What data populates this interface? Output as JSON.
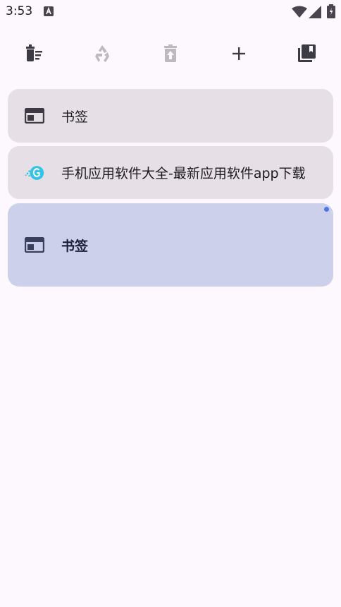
{
  "status_bar": {
    "time": "3:53",
    "icons": [
      "a-icon",
      "wifi-icon",
      "signal-icon",
      "battery-icon"
    ]
  },
  "toolbar": {
    "buttons": [
      {
        "name": "clear-all-icon",
        "enabled": true
      },
      {
        "name": "recycle-icon",
        "enabled": false
      },
      {
        "name": "trash-restore-icon",
        "enabled": false
      },
      {
        "name": "add-icon",
        "enabled": true
      },
      {
        "name": "collections-icon",
        "enabled": true
      }
    ]
  },
  "tabs": [
    {
      "title": "书签",
      "icon": "web-tab-icon",
      "selected": false
    },
    {
      "title": "手机应用软件大全-最新应用软件app下载",
      "icon": "site-favicon",
      "selected": false
    },
    {
      "title": "书签",
      "icon": "web-tab-icon",
      "selected": true
    }
  ],
  "colors": {
    "background": "#fcf8fe",
    "card": "#e6e0e6",
    "card_selected": "#ccd0ea",
    "indicator_dot": "#4e74e6"
  }
}
